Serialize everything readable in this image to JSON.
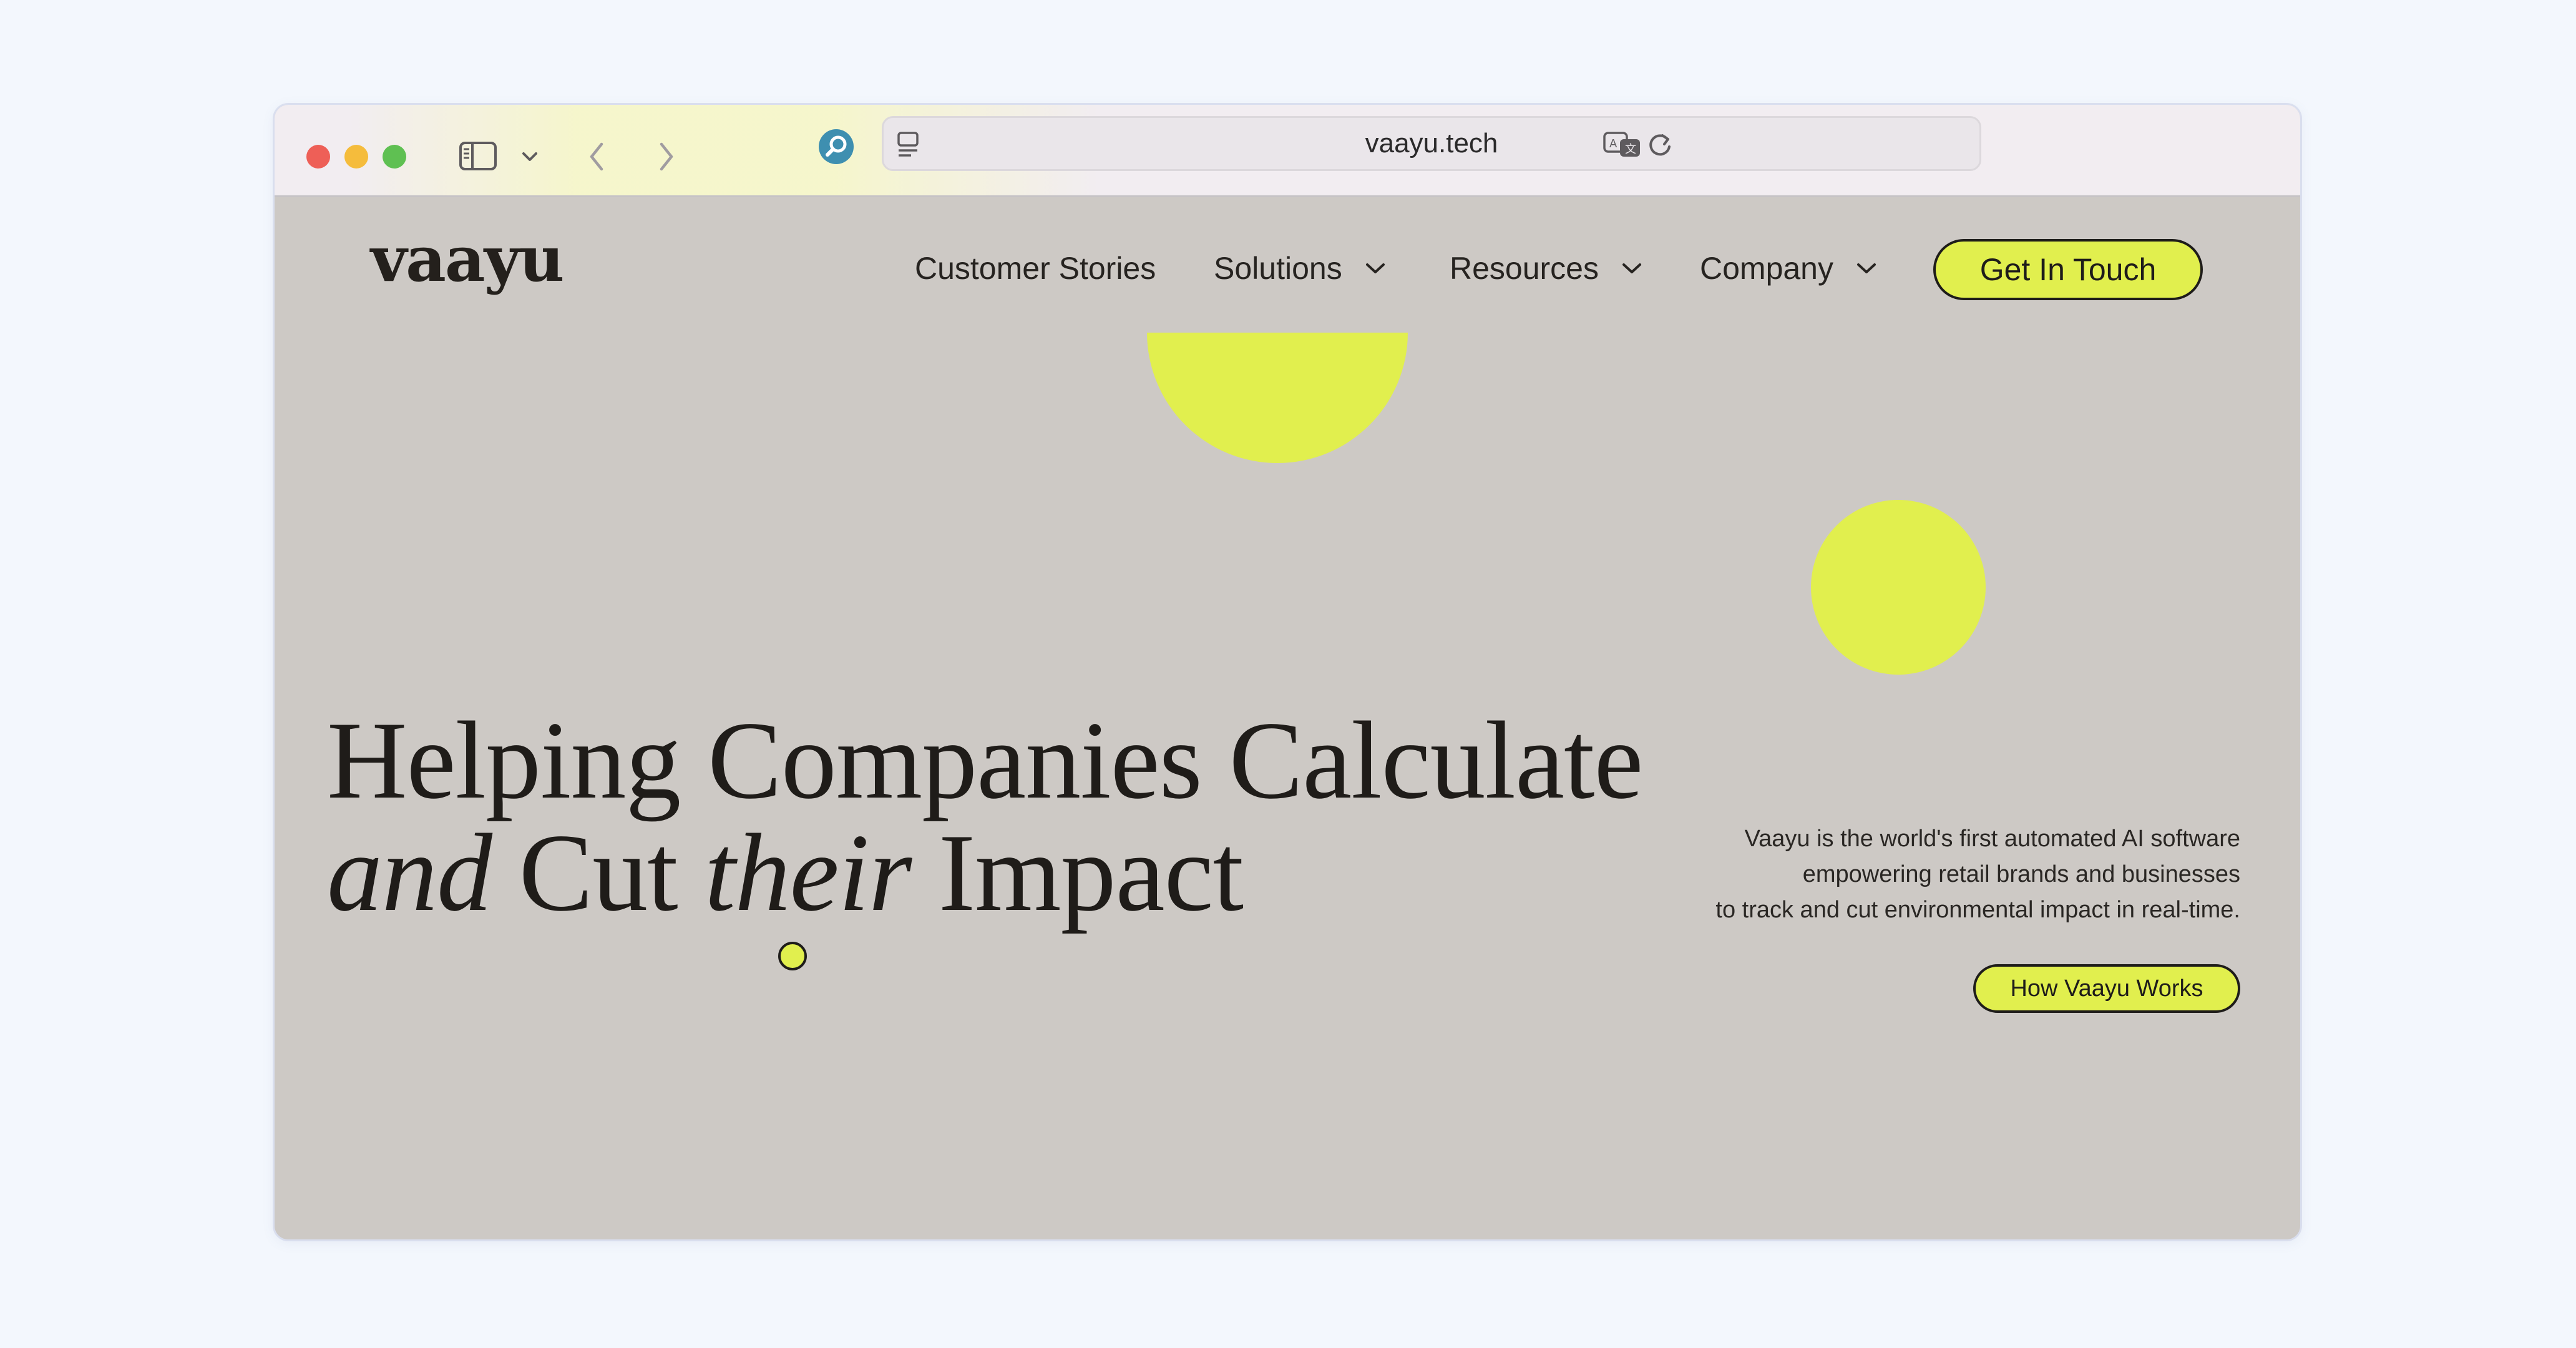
{
  "browser": {
    "url": "vaayu.tech",
    "colors": {
      "close": "#ee5f57",
      "minimize": "#f5bc3c",
      "maximize": "#5fc052"
    }
  },
  "site": {
    "logo": "vaayu",
    "nav": {
      "customer_stories": "Customer Stories",
      "solutions": "Solutions",
      "resources": "Resources",
      "company": "Company",
      "cta": "Get In Touch"
    },
    "hero": {
      "line1": "Helping Companies Calculate",
      "line2_and": "and",
      "line2_cut": "Cut",
      "line2_their": "their",
      "line2_impact": "Impact"
    },
    "description": {
      "line1": "Vaayu is the world's first automated AI software",
      "line2": "empowering retail brands and businesses",
      "line3": "to track and cut environmental impact in real-time."
    },
    "secondary_button": "How Vaayu Works",
    "accent_color": "#e1ef4e"
  }
}
